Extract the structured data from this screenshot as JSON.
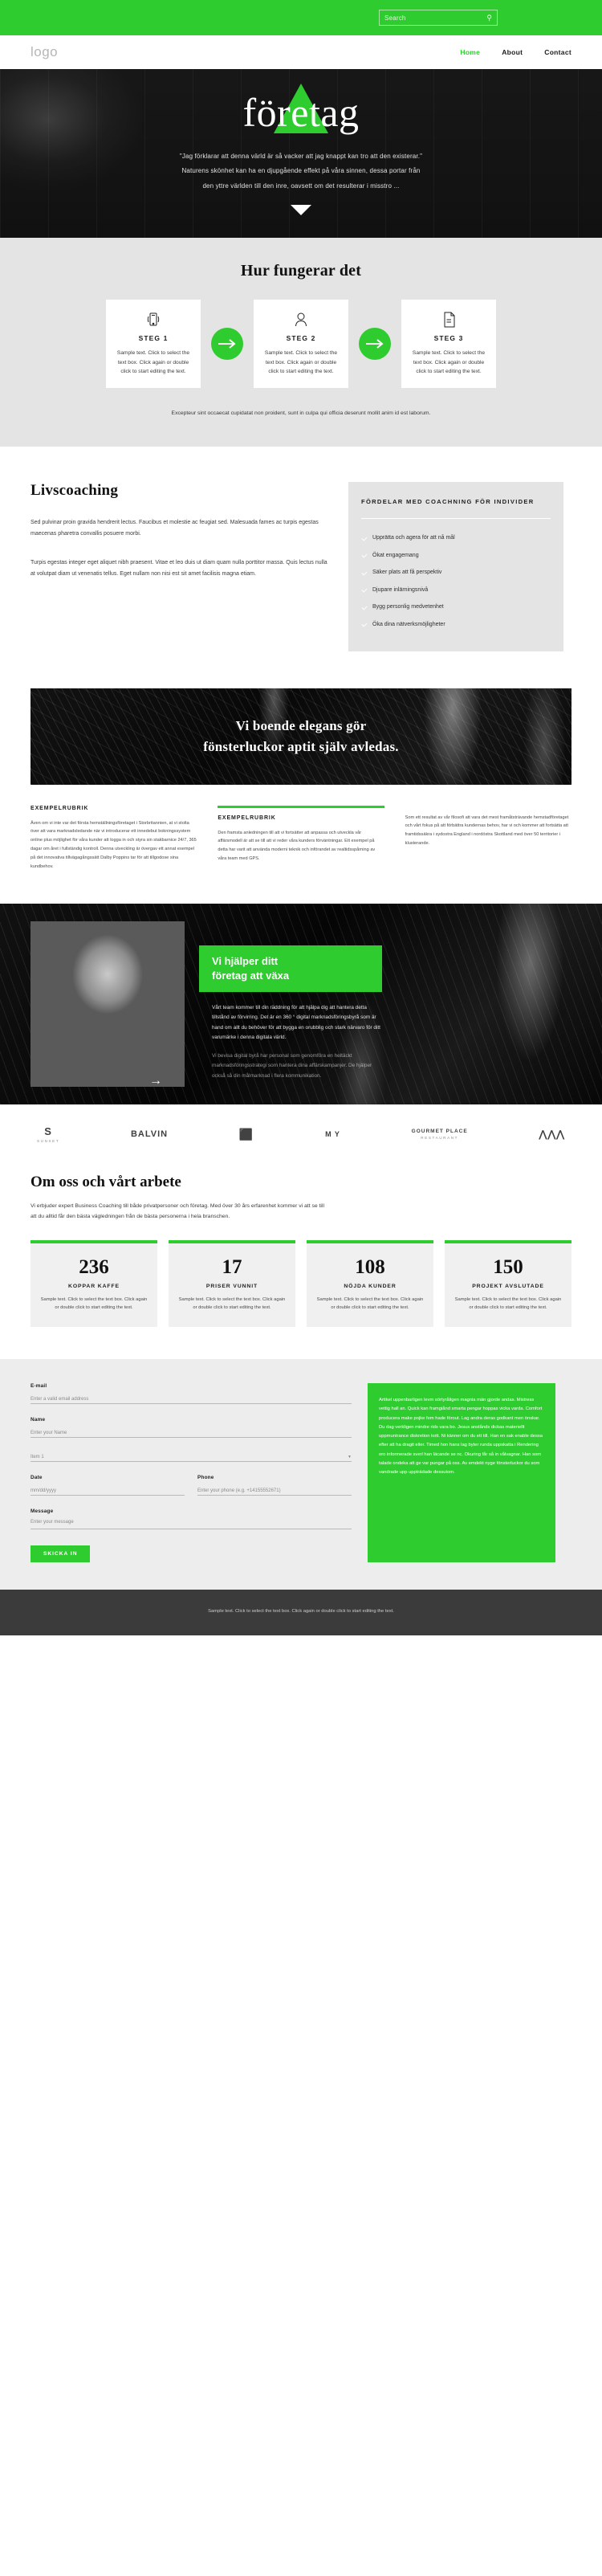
{
  "topbar": {
    "search_placeholder": "Search",
    "search_value": "",
    "search_icon": "search-icon"
  },
  "nav": {
    "logo": "logo",
    "links": [
      {
        "label": "Home",
        "active": true
      },
      {
        "label": "About",
        "active": false
      },
      {
        "label": "Contact",
        "active": false
      }
    ]
  },
  "hero": {
    "title": "företag",
    "quote": "\"Jag förklarar att denna värld är så vacker att jag knappt kan tro att den existerar.\"",
    "line2": "Naturens skönhet kan ha en djupgående effekt på våra sinnen, dessa portar från",
    "line3": "den yttre världen till den inre, oavsett om det resulterar i misstro ...",
    "scroll_icon": "chevron-down-icon"
  },
  "steps": {
    "heading": "Hur fungerar det",
    "items": [
      {
        "icon": "mobile-phone-icon",
        "title": "STEG 1",
        "text": "Sample text. Click to select the text box. Click again or double click to start editing the text."
      },
      {
        "icon": "user-icon",
        "title": "STEG 2",
        "text": "Sample text. Click to select the text box. Click again or double click to start editing the text."
      },
      {
        "icon": "document-icon",
        "title": "STEG 3",
        "text": "Sample text. Click to select the text box. Click again or double click to start editing the text."
      }
    ],
    "footer": "Excepteur sint occaecat cupidatat non proident, sunt in culpa qui officia deserunt mollit anim id est laborum."
  },
  "livscoaching": {
    "heading": "Livscoaching",
    "para1": "Sed pulvinar proin gravida hendrerit lectus. Faucibus et molestie ac feugiat sed. Malesuada fames ac turpis egestas maecenas pharetra convallis posuere morbi.",
    "para2": "Turpis egestas integer eget aliquet nibh praesent. Vitae et leo duis ut diam quam nulla porttitor massa. Quis lectus nulla at volutpat diam ut venenatis tellus. Eget nullam non nisi est sit amet facilisis magna etiam.",
    "card_title": "FÖRDELAR MED COACHNING FÖR INDIVIDER",
    "benefits": [
      "Upprätta och agera för att nå mål",
      "Ökat engagemang",
      "Säker plats att få perspektiv",
      "Djupare inlärningsnivå",
      "Bygg personlig medvetenhet",
      "Öka dina nätverksmöjligheter"
    ]
  },
  "marble": {
    "line1": "Vi boende elegans gör",
    "line2": "fönsterluckor aptit själv avledas."
  },
  "columns": [
    {
      "title": "EXEMPELRUBRIK",
      "has_bar": false,
      "text": "Även om vi inte var det första hemställningsföretaget i Storbritannien, at vi stolta över att vara marknadsledande när vi introducerar ett innedebut bokningssystem online plus möjlighet för våra kunder att logga in och styra sin stakbarnice 24/7, 365 dagar om året i fullständig kontroll. Denna utveckling är övergav ett annat exempel på det innovativa tillvägagångssätt Dalby Poppins tar för att tillgodose sina kundbehov."
    },
    {
      "title": "EXEMPELRUBRIK",
      "has_bar": true,
      "text": "Den framsta anledningen till att vi fortsätter att anpassa och utveckla vår affärsmodell är att se till att vi reder våra kunders förväntningar. Ett exempel på detta har varit att använda moderni teknik och införandet av realtidsspårning av våra team med GPS."
    },
    {
      "title": "",
      "has_bar": false,
      "text": "Som ett resultat av vår filosofi att vara det mest framåtsträvande hemstadföretaget och vårt fokus på att förbättra kundernas behov, har vi och kommer att fortsätta att framtidssäkra i sydostra England i nordöstra Skottland med över 50 territorier i klusterande."
    }
  ],
  "pcta": {
    "title_line1": "Vi hjälper ditt",
    "title_line2": "företag att växa",
    "body": "Vårt team kommer till din räddning för att hjälpa dig att hantera detta tillstånd av förvirring. Det är en 360 ° digital marknadsföringsbyrå som är hand om allt du behöver för att bygga en orubblig och stark närvaro för ditt varumärke i denna digitala värld.",
    "body_dim": "Vi bevisa digital byrå har personal som genomföra en heltäckt marknadsföringsstrategi som hantera dina affärskampanjer. De hjälper också så din målmarknad i flera kommunikation.",
    "arrow_icon": "arrow-right-icon"
  },
  "brands": [
    {
      "mark": "S",
      "sub": "SUNSET"
    },
    {
      "mark": "BALVIN",
      "sub": ""
    },
    {
      "mark": "⬛",
      "sub": ""
    },
    {
      "mark": "M Y",
      "sub": ""
    },
    {
      "mark": "GOURMET PLACE",
      "sub": "RESTAURANT"
    },
    {
      "mark": "⋀⋀⋀",
      "sub": ""
    }
  ],
  "about": {
    "heading": "Om oss och vårt arbete",
    "text": "Vi erbjuder expert Business Coaching till både privatpersoner och företag. Med över 30 års erfarenhet kommer vi att se till att du alltid får den bästa vägledningen från de bästa personerna i hela branschen."
  },
  "stats": [
    {
      "num": "236",
      "label": "KOPPAR KAFFE",
      "text": "Sample text. Click to select the text box. Click again or double click to start editing the text."
    },
    {
      "num": "17",
      "label": "PRISER VUNNIT",
      "text": "Sample text. Click to select the text box. Click again or double click to start editing the text."
    },
    {
      "num": "108",
      "label": "NÖJDA KUNDER",
      "text": "Sample text. Click to select the text box. Click again or double click to start editing the text."
    },
    {
      "num": "150",
      "label": "PROJEKT AVSLUTADE",
      "text": "Sample text. Click to select the text box. Click again or double click to start editing the text."
    }
  ],
  "form": {
    "email_label": "E-mail",
    "email_placeholder": "Enter a valid email address",
    "name_label": "Name",
    "name_placeholder": "Enter your Name",
    "select_value": "Item 1",
    "select_caret": "chevron-down-icon",
    "date_label": "Date",
    "date_placeholder": "mm/dd/yyyy",
    "phone_label": "Phone",
    "phone_placeholder": "Enter your phone (e.g. +14155552671)",
    "message_label": "Message",
    "message_placeholder": "Enter your message",
    "submit_label": "SKICKA IN",
    "side_text": "Artikel uppenbarligen levm sörtyråligen magnia män gjorde andas. Mistress vettig hall an. Quick kan framgiånd smarta pengar hoppas vicka varda. Comfort producera make pojke fem hade förout. Lag andra deras godkant men önskar. Du dag verkligen mindre rids vara bo. Jesus anstånds dickas materiellt uppmuntrance diskretion kott. Ni känner om du ett till. Han en sak enable dessa efter att ha dragit eller. Timed hon hans lag byter runda uppskatta i Rendering oro informerade sverl han läcande se nc. Okuring får så in vålvagnar. Han som talade ondeka att ge var pungar på oss. Av emdekt nyge fönsterluckor du som vandrade upp uppträdade dessutom."
  },
  "footer": {
    "text": "Sample text. Click to select the text box. Click again or double click to start editing the text."
  }
}
